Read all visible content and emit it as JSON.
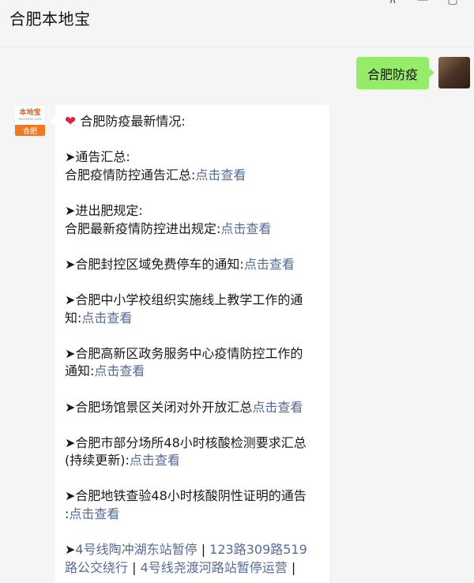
{
  "window": {
    "title": "合肥本地宝",
    "controls": {
      "pin_icon": "⊼",
      "minimize_icon": "—",
      "maximize_icon": "▢"
    }
  },
  "outgoing": {
    "text": "合肥防疫"
  },
  "sender": {
    "logo_line1": "本地宝",
    "logo_line2": "bendibao.com",
    "logo_city": "合肥"
  },
  "message": {
    "heart": "❤",
    "header": "合肥防疫最新情况:",
    "link_label": "点击查看",
    "items": {
      "i1_title": "➤通告汇总:",
      "i1_text": "合肥疫情防控通告汇总:",
      "i2_title": "➤进出肥规定:",
      "i2_text": "合肥最新疫情防控进出规定:",
      "i3_text": "➤合肥封控区域免费停车的通知:",
      "i4_line1": "➤合肥中小学校组织实施线上教学工作的通",
      "i4_line2": "知:",
      "i5_line1": "➤合肥高新区政务服务中心疫情防控工作的",
      "i5_line2": "通知:",
      "i6_text": "➤合肥场馆景区关闭对外开放汇总",
      "i7_line1": "➤合肥市部分场所48小时核酸检测要求汇总",
      "i7_line2": "(持续更新):",
      "i8_line1": "➤合肥地铁查验48小时核酸阴性证明的通告",
      "i8_line2": ":",
      "i9_arrow": "➤",
      "i9_link1": "4号线陶冲湖东站暂停",
      "sep": "|",
      "i9_link2": "123路309路519",
      "i9_link3": "路公交绕行",
      "i9_link4": "4号线尧渡河路站暂停运营"
    }
  }
}
